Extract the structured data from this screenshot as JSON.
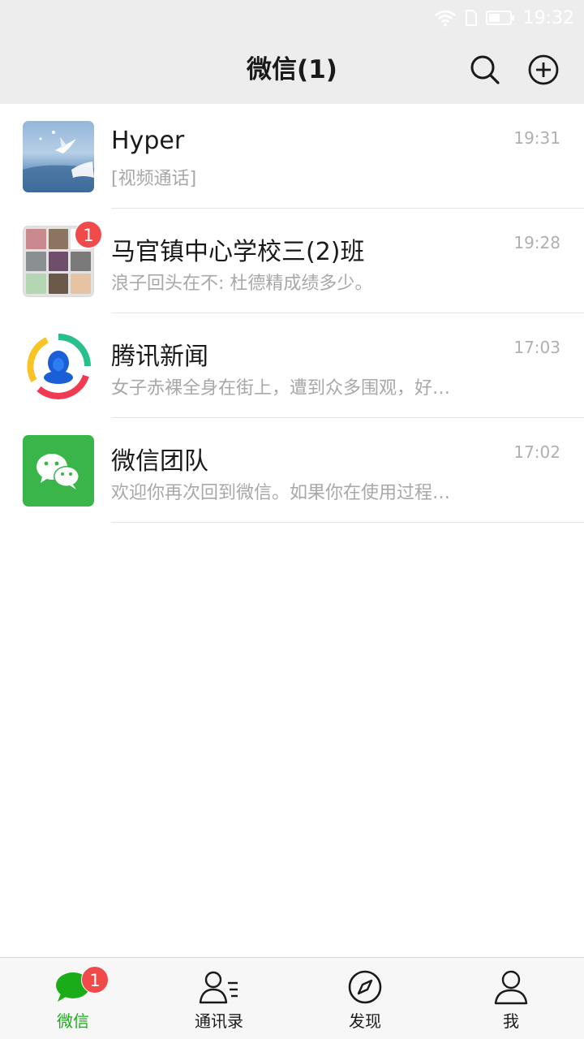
{
  "status_bar": {
    "time": "19:32",
    "icons": [
      "wifi-icon",
      "sim-icon",
      "battery-icon"
    ]
  },
  "header": {
    "title": "微信(1)",
    "search_icon": "search-icon",
    "add_icon": "plus-circle-icon"
  },
  "chats": [
    {
      "name": "Hyper",
      "preview": "[视频通话]",
      "time": "19:31",
      "avatar": "seagull-photo"
    },
    {
      "name": "马官镇中心学校三(2)班",
      "preview": "浪子回头在不: 杜德精成绩多少。",
      "time": "19:28",
      "avatar": "group-collage",
      "unread": "1"
    },
    {
      "name": "腾讯新闻",
      "preview": "女子赤裸全身在街上，遭到众多围观，好…",
      "time": "17:03",
      "avatar": "tencent-news-logo"
    },
    {
      "name": "微信团队",
      "preview": "欢迎你再次回到微信。如果你在使用过程…",
      "time": "17:02",
      "avatar": "wechat-logo"
    }
  ],
  "tabs": [
    {
      "label": "微信",
      "icon": "chat-bubble-icon",
      "active": true,
      "badge": "1"
    },
    {
      "label": "通讯录",
      "icon": "contacts-icon",
      "active": false
    },
    {
      "label": "发现",
      "icon": "compass-icon",
      "active": false
    },
    {
      "label": "我",
      "icon": "person-icon",
      "active": false
    }
  ],
  "colors": {
    "accent": "#1aad19",
    "badge": "#f04a4a",
    "header_bg": "#ededed",
    "tabbar_bg": "#f7f7f7"
  }
}
